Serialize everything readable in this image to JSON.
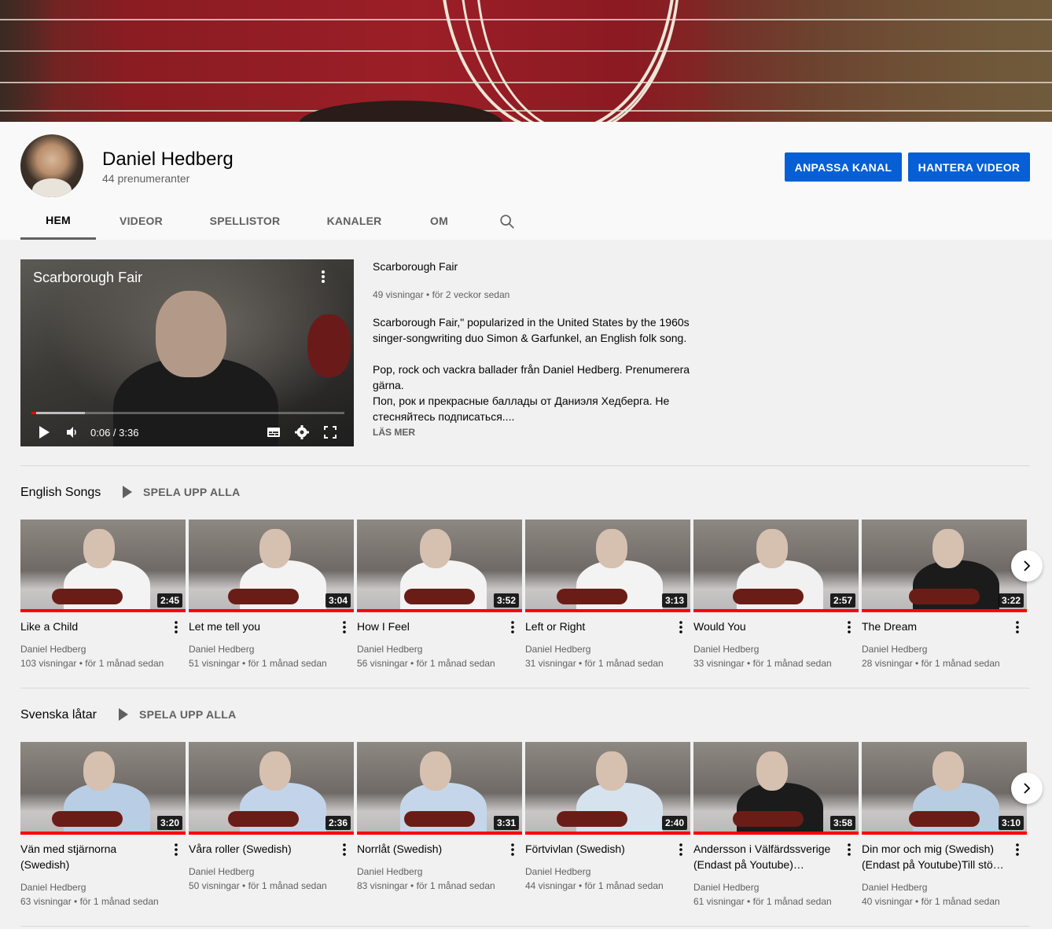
{
  "channel": {
    "name": "Daniel Hedberg",
    "subscribers": "44 prenumeranter",
    "customize_label": "ANPASSA KANAL",
    "manage_label": "HANTERA VIDEOR"
  },
  "tabs": [
    {
      "label": "HEM",
      "active": true
    },
    {
      "label": "VIDEOR",
      "active": false
    },
    {
      "label": "SPELLISTOR",
      "active": false
    },
    {
      "label": "KANALER",
      "active": false
    },
    {
      "label": "OM",
      "active": false
    }
  ],
  "featured": {
    "player_title": "Scarborough Fair",
    "time": "0:06 / 3:36",
    "progress_fraction": 0.016,
    "title": "Scarborough Fair",
    "views": "49 visningar",
    "age": "för 2 veckor sedan",
    "description": [
      "Scarborough Fair,\" popularized in the United States by the 1960s singer-songwriting duo Simon & Garfunkel, an English folk song.",
      "",
      "Pop, rock och vackra ballader från Daniel Hedberg. Prenumerera gärna.",
      "Поп, рок и прекрасные баллады от Даниэля Хедберга. Не стесняйтесь подписаться...."
    ],
    "more_label": "LÄS MER"
  },
  "shelves": [
    {
      "title": "English Songs",
      "play_all": "SPELA UPP ALLA",
      "videos": [
        {
          "title": "Like a Child",
          "duration": "2:45",
          "channel": "Daniel Hedberg",
          "views": "103 visningar",
          "age": "för 1 månad sedan"
        },
        {
          "title": "Let me tell you",
          "duration": "3:04",
          "channel": "Daniel Hedberg",
          "views": "51 visningar",
          "age": "för 1 månad sedan"
        },
        {
          "title": "How I Feel",
          "duration": "3:52",
          "channel": "Daniel Hedberg",
          "views": "56 visningar",
          "age": "för 1 månad sedan"
        },
        {
          "title": "Left or Right",
          "duration": "3:13",
          "channel": "Daniel Hedberg",
          "views": "31 visningar",
          "age": "för 1 månad sedan"
        },
        {
          "title": "Would You",
          "duration": "2:57",
          "channel": "Daniel Hedberg",
          "views": "33 visningar",
          "age": "för 1 månad sedan"
        },
        {
          "title": "The Dream",
          "duration": "3:22",
          "channel": "Daniel Hedberg",
          "views": "28 visningar",
          "age": "för 1 månad sedan"
        }
      ]
    },
    {
      "title": "Svenska låtar",
      "play_all": "SPELA UPP ALLA",
      "videos": [
        {
          "title": "Vän med stjärnorna (Swedish)",
          "duration": "3:20",
          "channel": "Daniel Hedberg",
          "views": "63 visningar",
          "age": "för 1 månad sedan"
        },
        {
          "title": "Våra roller (Swedish)",
          "duration": "2:36",
          "channel": "Daniel Hedberg",
          "views": "50 visningar",
          "age": "för 1 månad sedan"
        },
        {
          "title": "Norrlåt (Swedish)",
          "duration": "3:31",
          "channel": "Daniel Hedberg",
          "views": "83 visningar",
          "age": "för 1 månad sedan"
        },
        {
          "title": "Förtvivlan (Swedish)",
          "duration": "2:40",
          "channel": "Daniel Hedberg",
          "views": "44 visningar",
          "age": "för 1 månad sedan"
        },
        {
          "title": "Andersson i Välfärdssverige (Endast på Youtube)…",
          "duration": "3:58",
          "channel": "Daniel Hedberg",
          "views": "61 visningar",
          "age": "för 1 månad sedan"
        },
        {
          "title": "Din mor och mig (Swedish) (Endast på Youtube)Till stö…",
          "duration": "3:10",
          "channel": "Daniel Hedberg",
          "views": "40 visningar",
          "age": "för 1 månad sedan"
        }
      ]
    }
  ],
  "icons": {
    "search": "search-icon",
    "more": "more-vert-icon",
    "next": "chevron-right-icon",
    "play": "play-icon",
    "volume": "volume-icon",
    "subtitles": "subtitles-icon",
    "settings": "gear-icon",
    "fullscreen": "fullscreen-icon"
  },
  "colors": {
    "accent": "#065fd4",
    "progress": "#ff0000"
  }
}
